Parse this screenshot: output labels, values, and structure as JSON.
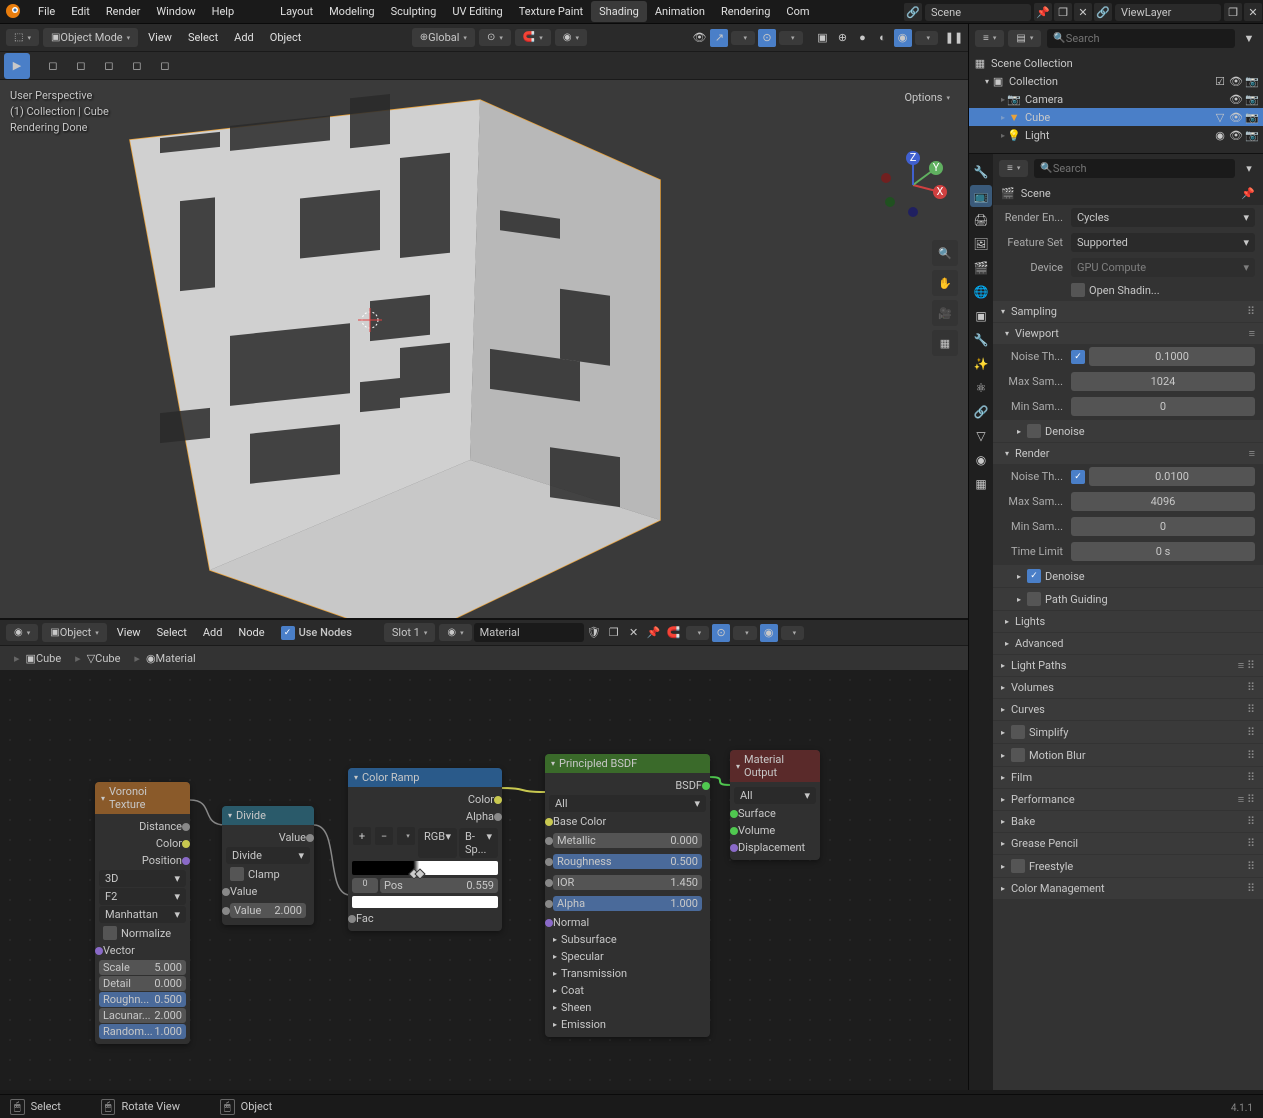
{
  "top_menu": [
    "File",
    "Edit",
    "Render",
    "Window",
    "Help"
  ],
  "workspaces": {
    "items": [
      "Layout",
      "Modeling",
      "Sculpting",
      "UV Editing",
      "Texture Paint",
      "Shading",
      "Animation",
      "Rendering",
      "Com"
    ],
    "active": "Shading"
  },
  "scene_name": "Scene",
  "viewlayer_name": "ViewLayer",
  "version": "4.1.1",
  "viewport": {
    "mode": "Object Mode",
    "menus": [
      "View",
      "Select",
      "Add",
      "Object"
    ],
    "orient": "Global",
    "options_btn": "Options",
    "info": [
      "User Perspective",
      "(1) Collection | Cube",
      "Rendering Done"
    ]
  },
  "shader": {
    "mode": "Object",
    "menus": [
      "View",
      "Select",
      "Add",
      "Node"
    ],
    "use_nodes": "Use Nodes",
    "slot": "Slot 1",
    "material": "Material",
    "breadcrumb": [
      "Cube",
      "Cube",
      "Material"
    ]
  },
  "nodes": {
    "voronoi": {
      "title": "Voronoi Texture",
      "outputs": [
        "Distance",
        "Color",
        "Position"
      ],
      "dim": "3D",
      "feat": "F2",
      "dist": "Manhattan",
      "normalize": "Normalize",
      "vector": "Vector",
      "fields": [
        [
          "Scale",
          "5.000"
        ],
        [
          "Detail",
          "0.000"
        ],
        [
          "Roughn...",
          "0.500"
        ],
        [
          "Lacunar...",
          "2.000"
        ],
        [
          "Random...",
          "1.000"
        ]
      ]
    },
    "divide": {
      "title": "Divide",
      "out": "Value",
      "op": "Divide",
      "clamp": "Clamp",
      "in": "Value",
      "field": [
        "Value",
        "2.000"
      ]
    },
    "ramp": {
      "title": "Color Ramp",
      "outs": [
        "Color",
        "Alpha"
      ],
      "mode1": "RGB",
      "mode2": "B-Sp...",
      "stop": "0",
      "pos_label": "Pos",
      "pos": "0.559",
      "fac": "Fac"
    },
    "bsdf": {
      "title": "Principled BSDF",
      "out": "BSDF",
      "preset": "All",
      "base": "Base Color",
      "fields": [
        [
          "Metallic",
          "0.000"
        ],
        [
          "Roughness",
          "0.500"
        ],
        [
          "IOR",
          "1.450"
        ],
        [
          "Alpha",
          "1.000"
        ]
      ],
      "normal": "Normal",
      "groups": [
        "Subsurface",
        "Specular",
        "Transmission",
        "Coat",
        "Sheen",
        "Emission"
      ]
    },
    "out": {
      "title": "Material Output",
      "preset": "All",
      "ins": [
        "Surface",
        "Volume",
        "Displacement"
      ]
    }
  },
  "statusbar": {
    "select": "Select",
    "rotate": "Rotate View",
    "object": "Object"
  },
  "outliner": {
    "search_placeholder": "Search",
    "root": "Scene Collection",
    "collection": "Collection",
    "items": [
      {
        "name": "Camera",
        "icon": "📷"
      },
      {
        "name": "Cube",
        "icon": "▼",
        "sel": true
      },
      {
        "name": "Light",
        "icon": "💡"
      }
    ]
  },
  "props": {
    "search_placeholder": "Search",
    "scene_label": "Scene",
    "render_engine": {
      "label": "Render En...",
      "value": "Cycles"
    },
    "feature_set": {
      "label": "Feature Set",
      "value": "Supported"
    },
    "device": {
      "label": "Device",
      "value": "GPU Compute"
    },
    "open_shading": "Open Shadin...",
    "sampling": "Sampling",
    "viewport_head": "Viewport",
    "noise_th": {
      "label": "Noise Th...",
      "chk": true,
      "value": "0.1000"
    },
    "max_sam": {
      "label": "Max Sam...",
      "value": "1024"
    },
    "min_sam": {
      "label": "Min Sam...",
      "value": "0"
    },
    "denoise": "Denoise",
    "render_head": "Render",
    "r_noise": {
      "label": "Noise Th...",
      "chk": true,
      "value": "0.0100"
    },
    "r_max": {
      "label": "Max Sam...",
      "value": "4096"
    },
    "r_min": {
      "label": "Min Sam...",
      "value": "0"
    },
    "r_time": {
      "label": "Time Limit",
      "value": "0 s"
    },
    "r_denoise": "Denoise",
    "path_guiding": "Path Guiding",
    "lights": "Lights",
    "advanced": "Advanced",
    "panels": [
      "Light Paths",
      "Volumes",
      "Curves",
      "Simplify",
      "Motion Blur",
      "Film",
      "Performance",
      "Bake",
      "Grease Pencil",
      "Freestyle",
      "Color Management"
    ]
  }
}
